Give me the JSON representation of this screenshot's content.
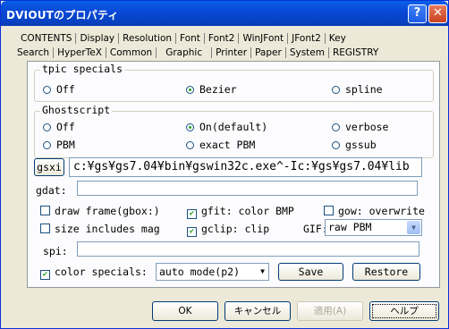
{
  "window": {
    "title": "DVIOUTのプロパティ",
    "help": "?",
    "close": "✕"
  },
  "tabs": {
    "row1": [
      "CONTENTS",
      "Display",
      "Resolution",
      "Font",
      "Font2",
      "WinJFont",
      "JFont2",
      "Key"
    ],
    "row2": [
      "Search",
      "HyperTeX",
      "Common",
      "Graphic",
      "Printer",
      "Paper",
      "System",
      "REGISTRY"
    ],
    "active": "Graphic"
  },
  "tpic": {
    "legend": "tpic specials",
    "off": "Off",
    "bezier": "Bezier",
    "spline": "spline",
    "selected": "bezier"
  },
  "ghost": {
    "legend": "Ghostscript",
    "off": "Off",
    "on_default": "On(default)",
    "verbose": "verbose",
    "pbm": "PBM",
    "exact_pbm": "exact PBM",
    "gssub": "gssub",
    "selected": "on_default"
  },
  "gsx": {
    "button": "gsxi",
    "value": "c:¥gs¥gs7.04¥bin¥gswin32c.exe^-Ic:¥gs¥gs7.04¥lib"
  },
  "gdat": {
    "label": "gdat:",
    "value": ""
  },
  "options": {
    "draw_frame": "draw frame(gbox:)",
    "gfit": "gfit: color BMP",
    "gow": "gow: overwrite",
    "size_mag": "size includes mag",
    "gclip": "gclip: clip",
    "gif_label": "GIF:",
    "gif_value": "raw PBM"
  },
  "spi": {
    "label": "spi:",
    "value": ""
  },
  "color": {
    "label": "color specials:",
    "mode": "auto mode(p2)",
    "save": "Save",
    "restore": "Restore"
  },
  "footer": {
    "ok": "OK",
    "cancel": "キャンセル",
    "apply": "適用(A)",
    "help": "ヘルプ"
  }
}
